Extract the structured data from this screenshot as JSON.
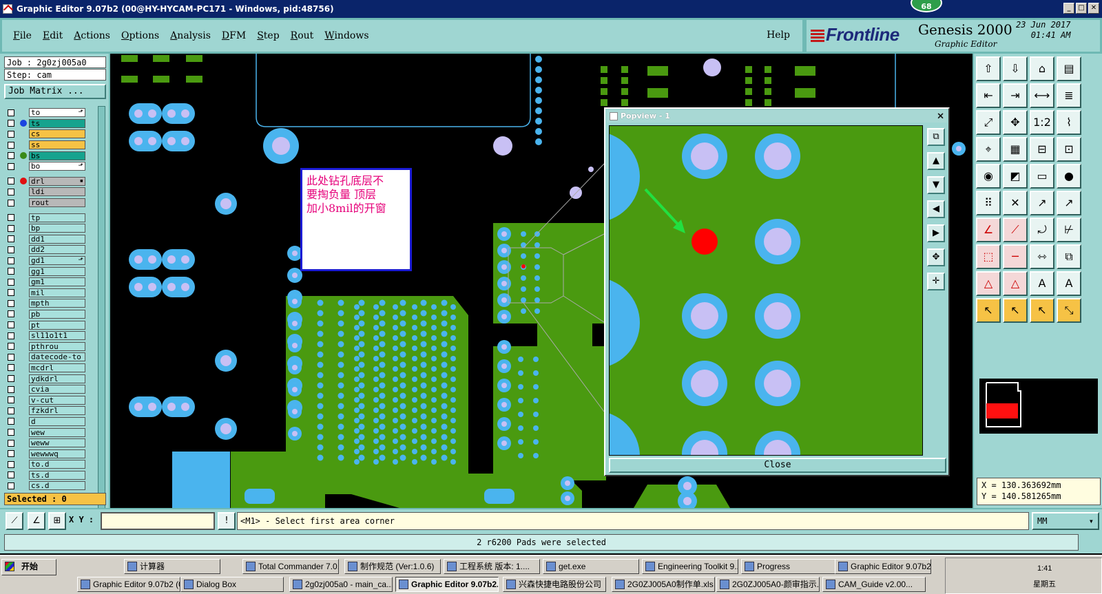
{
  "window": {
    "title": "Graphic Editor 9.07b2 (00@HY-HYCAM-PC171 - Windows, pid:48756)",
    "badge": "68"
  },
  "menu": {
    "items": [
      "File",
      "Edit",
      "Actions",
      "Options",
      "Analysis",
      "DFM",
      "Step",
      "Rout",
      "Windows"
    ],
    "underline": [
      "F",
      "E",
      "A",
      "O",
      "A",
      "D",
      "S",
      "R",
      "W"
    ],
    "help": "Help"
  },
  "brand": {
    "logo": "Frontline",
    "product": "Genesis 2000",
    "subtitle": "Graphic Editor",
    "date": "23 Jun 2017",
    "time": "01:41 AM"
  },
  "left": {
    "job": "Job : 2g0zj005a0",
    "step": "Step: cam",
    "job_matrix": "Job Matrix ...",
    "selected": "Selected : 0",
    "layers_group1": [
      {
        "name": "to",
        "style": "w",
        "dot": "",
        "mark": "⬏"
      },
      {
        "name": "ts",
        "style": "t",
        "dot": "#1b44e0",
        "mark": ""
      },
      {
        "name": "cs",
        "style": "y",
        "dot": "",
        "mark": ""
      },
      {
        "name": "ss",
        "style": "y",
        "dot": "",
        "mark": ""
      },
      {
        "name": "bs",
        "style": "t",
        "dot": "#3a8a18",
        "mark": ""
      },
      {
        "name": "bo",
        "style": "w",
        "dot": "",
        "mark": "⬏"
      }
    ],
    "layers_group2": [
      {
        "name": "drl",
        "style": "g",
        "dot": "#e01010",
        "mark": "▪"
      },
      {
        "name": "ldi",
        "style": "g",
        "dot": "",
        "mark": ""
      },
      {
        "name": "rout",
        "style": "g",
        "dot": "",
        "mark": ""
      }
    ],
    "layers_group3": [
      {
        "name": "tp",
        "mark": ""
      },
      {
        "name": "bp",
        "mark": ""
      },
      {
        "name": "dd1",
        "mark": ""
      },
      {
        "name": "dd2",
        "mark": ""
      },
      {
        "name": "gd1",
        "mark": "⬏"
      },
      {
        "name": "gg1",
        "mark": ""
      },
      {
        "name": "gm1",
        "mark": ""
      },
      {
        "name": "mil",
        "mark": ""
      },
      {
        "name": "mpth",
        "mark": ""
      },
      {
        "name": "pb",
        "mark": ""
      },
      {
        "name": "pt",
        "mark": ""
      },
      {
        "name": "sl11o1t1",
        "mark": ""
      },
      {
        "name": "pthrou",
        "mark": ""
      },
      {
        "name": "datecode-to",
        "mark": ""
      },
      {
        "name": "mcdrl",
        "mark": ""
      },
      {
        "name": "ydkdrl",
        "mark": ""
      },
      {
        "name": "cvia",
        "mark": ""
      },
      {
        "name": "v-cut",
        "mark": ""
      },
      {
        "name": "fzkdrl",
        "mark": ""
      },
      {
        "name": "d",
        "mark": ""
      },
      {
        "name": "wew",
        "mark": ""
      },
      {
        "name": "weww",
        "mark": ""
      },
      {
        "name": "wewwwq",
        "mark": ""
      },
      {
        "name": "to.d",
        "mark": ""
      },
      {
        "name": "ts.d",
        "mark": ""
      },
      {
        "name": "cs.d",
        "mark": ""
      }
    ]
  },
  "note": {
    "lines": [
      "此处钻孔底层不",
      "要掏负量  顶层",
      "加小8mil的开窗"
    ],
    "color": "#e6007a"
  },
  "popview": {
    "title": "Popview - 1",
    "close_label": "Close",
    "close_x": "✕"
  },
  "right": {
    "x": "X = 130.363692mm",
    "y": "Y = 140.581265mm"
  },
  "command": {
    "xy_label": "X Y :",
    "xy_value": "",
    "prompt": "<M1> - Select first area corner",
    "unit": "MM",
    "unit_arrow": "▾",
    "status": "2 r6200 Pads were selected"
  },
  "taskbar": {
    "start": "开始",
    "row1": [
      {
        "label": "计算器"
      },
      {
        "label": "Total Commander 7.0..."
      },
      {
        "label": "制作规范 (Ver:1.0.6)"
      },
      {
        "label": "工程系统  版本: 1...."
      },
      {
        "label": "get.exe"
      },
      {
        "label": "Engineering Toolkit 9...."
      },
      {
        "label": "Progress"
      },
      {
        "label": "Graphic Editor 9.07b2..."
      }
    ],
    "row2": [
      {
        "label": "Graphic Editor 9.07b2 (0..."
      },
      {
        "label": "Dialog Box"
      },
      {
        "label": "2g0zj005a0 - main_ca..."
      },
      {
        "label": "Graphic Editor 9.07b2..."
      },
      {
        "label": "兴森快捷电路股份公司"
      },
      {
        "label": "2G0ZJ005A0制作单.xls"
      },
      {
        "label": "2G0ZJ005A0-颜审指示..."
      },
      {
        "label": "CAM_Guide v2.00..."
      }
    ],
    "clock": "1:41",
    "day": "星期五"
  },
  "colors": {
    "panel": "#9fd6d2",
    "copper": "#4a9a10",
    "pad": "#4ab4ee",
    "hole": "#c8c0f4",
    "selected_pad": "#ff0000"
  }
}
